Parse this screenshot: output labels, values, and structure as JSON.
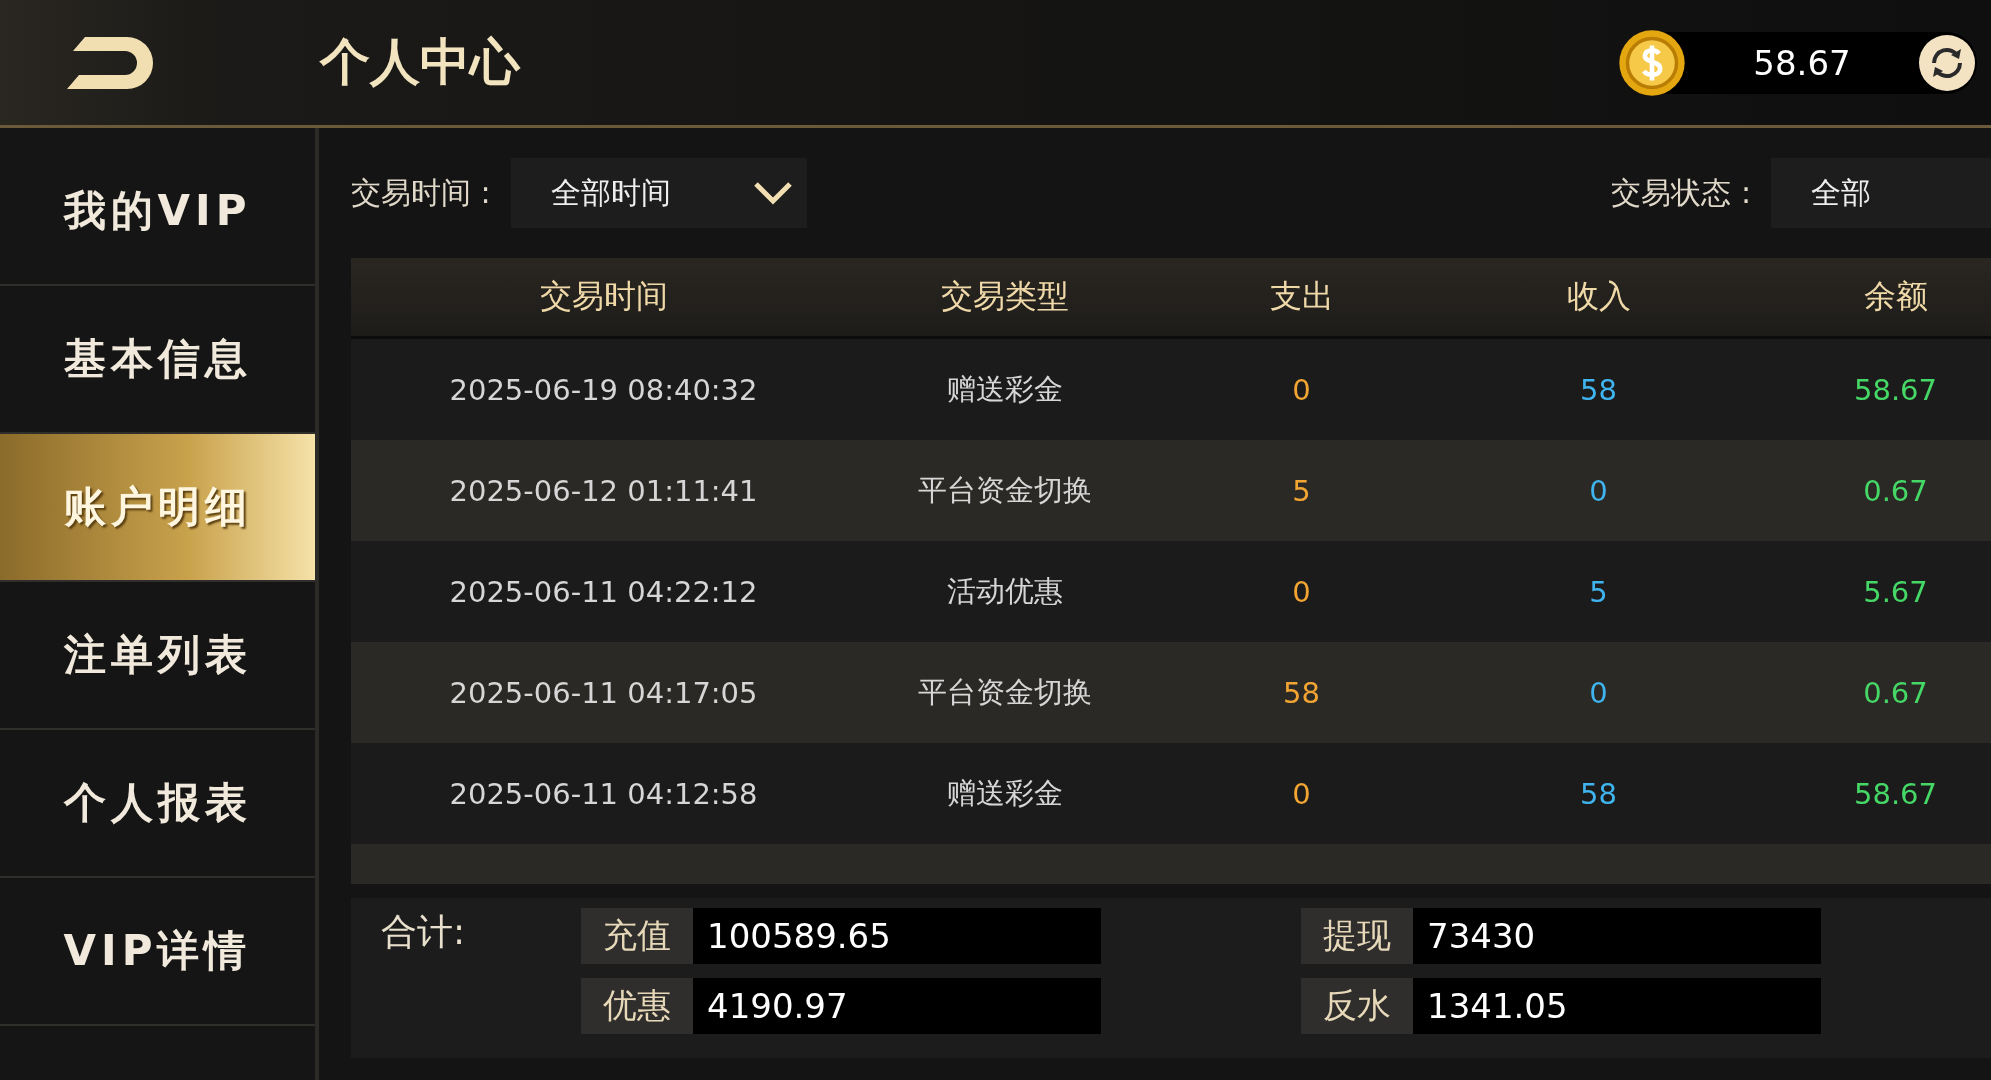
{
  "header": {
    "title": "个人中心",
    "balance": "58.67"
  },
  "sidebar": {
    "items": [
      {
        "label": "我的VIP",
        "selected": false
      },
      {
        "label": "基本信息",
        "selected": false
      },
      {
        "label": "账户明细",
        "selected": true
      },
      {
        "label": "注单列表",
        "selected": false
      },
      {
        "label": "个人报表",
        "selected": false
      },
      {
        "label": "VIP详情",
        "selected": false
      }
    ]
  },
  "filters": {
    "time_label": "交易时间 :",
    "time_value": "全部时间",
    "status_label": "交易状态 :",
    "status_value": "全部"
  },
  "table": {
    "columns": [
      "交易时间",
      "交易类型",
      "支出",
      "收入",
      "余额"
    ],
    "rows": [
      [
        "2025-06-19 08:40:32",
        "赠送彩金",
        "0",
        "58",
        "58.67"
      ],
      [
        "2025-06-12 01:11:41",
        "平台资金切换",
        "5",
        "0",
        "0.67"
      ],
      [
        "2025-06-11 04:22:12",
        "活动优惠",
        "0",
        "5",
        "5.67"
      ],
      [
        "2025-06-11 04:17:05",
        "平台资金切换",
        "58",
        "0",
        "0.67"
      ],
      [
        "2025-06-11 04:12:58",
        "赠送彩金",
        "0",
        "58",
        "58.67"
      ]
    ]
  },
  "totals": {
    "label": "合计:",
    "items": [
      {
        "label": "充值",
        "value": "100589.65"
      },
      {
        "label": "提现",
        "value": "73430"
      },
      {
        "label": "优惠",
        "value": "4190.97"
      },
      {
        "label": "反水",
        "value": "1341.05"
      }
    ]
  }
}
